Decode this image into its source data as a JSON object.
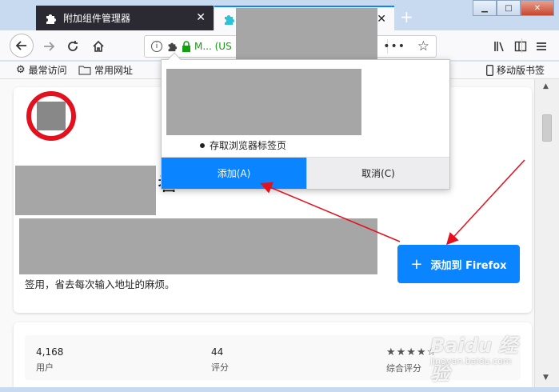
{
  "tabs": [
    {
      "label": "附加组件管理器",
      "icon": "puzzle-icon",
      "active": false
    },
    {
      "label": "",
      "icon": "puzzle-icon",
      "active": true
    }
  ],
  "new_tab_label": "+",
  "window_buttons": {
    "minimize": "▁",
    "maximize": "□",
    "close": "✕"
  },
  "toolbar": {
    "url_text": "M... (US",
    "more_label": "•••",
    "star_label": "☆"
  },
  "bookmarks": [
    {
      "label": "最常访问",
      "icon": "gear-icon"
    },
    {
      "label": "常用网址",
      "icon": "folder-icon"
    },
    {
      "label": "移动版书签",
      "icon": "mobile-icon"
    }
  ],
  "page": {
    "title_peek": "者 用",
    "description_tail": "签用，省去每次输入地址的麻烦。",
    "install_button": "添加到 Firefox",
    "install_plus": "+"
  },
  "stats": [
    {
      "value": "4,168",
      "label": "用户"
    },
    {
      "value": "44",
      "label": "评分"
    },
    {
      "value": "★★★★☆",
      "label": "综合评分"
    }
  ],
  "popup": {
    "permission": "存取浏览器标签页",
    "add_button": "添加(A)",
    "cancel_button": "取消(C)"
  },
  "watermark": {
    "brand": "Baidu 经验",
    "url": "jingyan.baidu.com"
  },
  "colors": {
    "accent": "#0a84ff",
    "arrow": "#e3101e",
    "lock": "#12a10e"
  }
}
